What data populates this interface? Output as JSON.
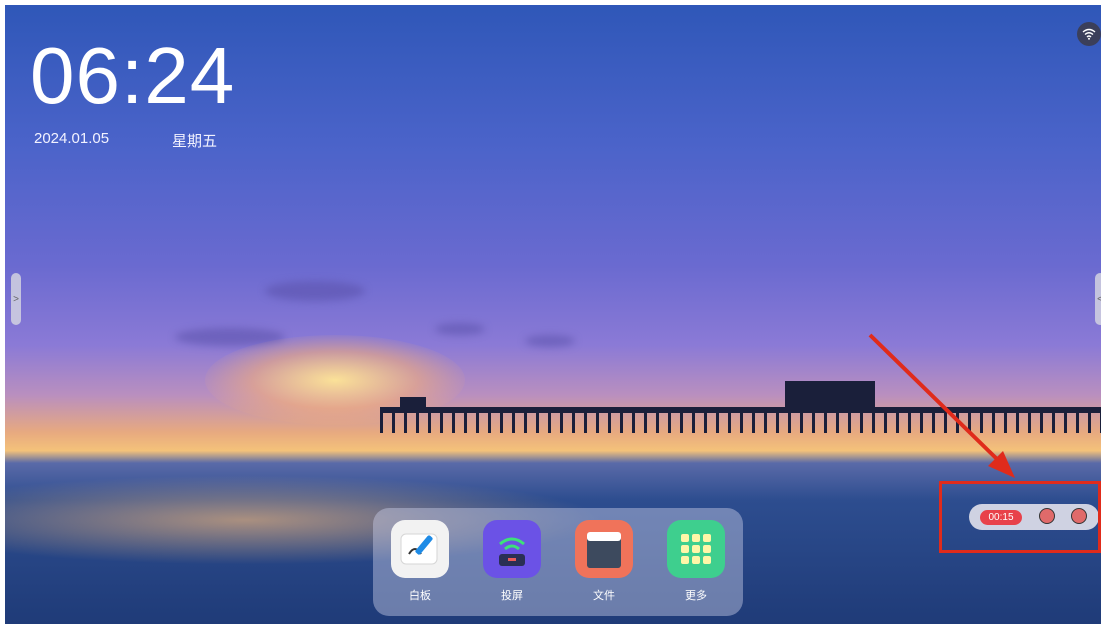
{
  "clock": {
    "time": "06:24",
    "date": "2024.01.05",
    "weekday": "星期五"
  },
  "status": {
    "wifi_icon": "wifi-icon"
  },
  "dock": {
    "apps": [
      {
        "label": "白板",
        "icon": "whiteboard-icon",
        "color": "#f2f2f2"
      },
      {
        "label": "投屏",
        "icon": "screen-cast-icon",
        "color": "#6b52e6"
      },
      {
        "label": "文件",
        "icon": "folder-icon",
        "color": "#f0735a"
      },
      {
        "label": "更多",
        "icon": "grid-icon",
        "color": "#3ecf8e"
      }
    ]
  },
  "recording": {
    "timer": "00:15"
  },
  "colors": {
    "highlight": "#e02b1b",
    "record_badge": "#e8414a"
  }
}
